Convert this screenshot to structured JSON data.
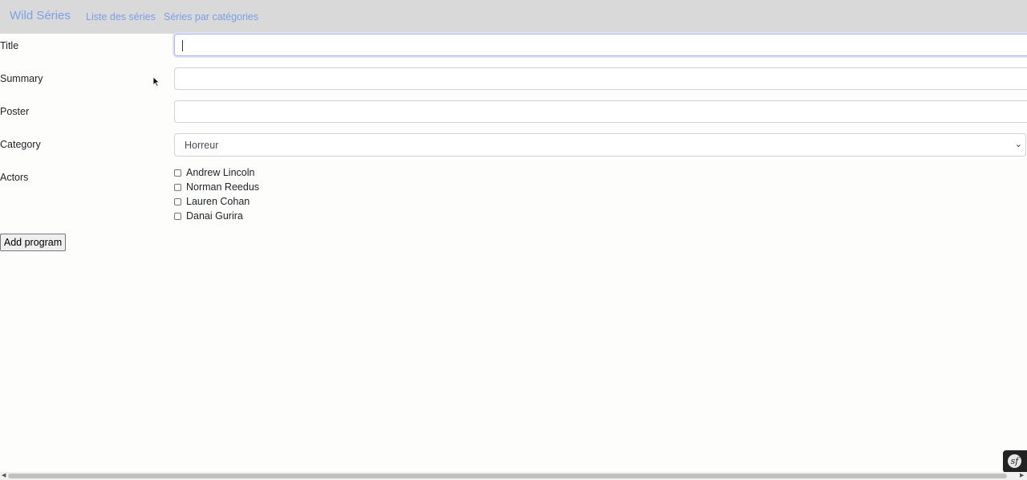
{
  "navbar": {
    "brand": "Wild Séries",
    "links": [
      "Liste des séries",
      "Séries par catégories"
    ]
  },
  "form": {
    "title_label": "Title",
    "title_value": "",
    "summary_label": "Summary",
    "summary_value": "",
    "poster_label": "Poster",
    "poster_value": "",
    "category_label": "Category",
    "category_selected": "Horreur",
    "actors_label": "Actors",
    "actors": [
      "Andrew Lincoln",
      "Norman Reedus",
      "Lauren Cohan",
      "Danai Gurira"
    ],
    "submit_label": "Add program"
  },
  "icons": {
    "select_chevron": "chevron-down-icon",
    "toolbar_logo": "symfony-logo-icon",
    "cursor": "mouse-pointer-icon"
  },
  "colors": {
    "navbar_bg": "#d9d9d9",
    "link": "#7b9fe8",
    "focus_border": "#aeb8ee"
  }
}
